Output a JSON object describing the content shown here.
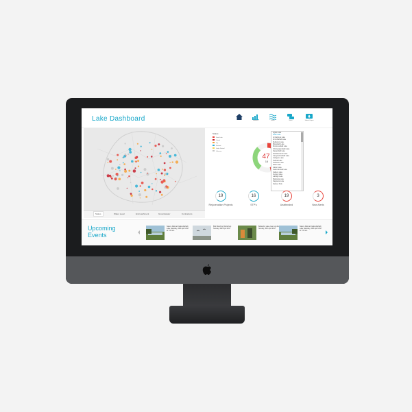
{
  "header": {
    "title": "Lake Dashboard",
    "nav": [
      {
        "icon": "home-icon",
        "label": ""
      },
      {
        "icon": "bar-chart-icon",
        "label": "Statistics"
      },
      {
        "icon": "water-waves-icon",
        "label": "Water"
      },
      {
        "icon": "chat-icon",
        "label": "News"
      },
      {
        "icon": "upload-icon",
        "label": "Submit Report"
      }
    ]
  },
  "map": {
    "tabs": [
      "Status",
      "Water Level",
      "Encroachment",
      "Groundwater",
      "Contractors"
    ],
    "active_tab": "Status",
    "point_colors": [
      "#e8443b",
      "#f6a23a",
      "#c51e2e",
      "#2bb0d6",
      "#c7c7c7"
    ]
  },
  "legend": {
    "title": "Status",
    "items": [
      {
        "label": "Dead Lake",
        "color": "#e8443b"
      },
      {
        "label": "Critical",
        "color": "#c51e2e"
      },
      {
        "label": "Dry",
        "color": "#f6a23a"
      },
      {
        "label": "Revived",
        "color": "#2bb0d6"
      },
      {
        "label": "Under Revival",
        "color": "#f1d35a"
      },
      {
        "label": "Unknown",
        "color": "#c7c7c7"
      }
    ]
  },
  "donut": {
    "center_value": "47",
    "sub_value": "16",
    "segments": [
      {
        "color": "#e8443b",
        "fraction": 0.46
      },
      {
        "color": "#f2f2f2",
        "fraction": 0.14
      },
      {
        "color": "#8dd57b",
        "fraction": 0.28
      },
      {
        "color": "#f3f3f3",
        "fraction": 0.12
      }
    ]
  },
  "lake_list": {
    "items": [
      "Agara Lake",
      "Allalli Lake",
      "Ambalipura Lake",
      "Amruthahalli Lake",
      "Bellandur Lake",
      "Bilekahalli Lake",
      "Bommanahalli Lake",
      "Chinnappanahalli Lake",
      "Dasarahalli Lake",
      "Doddanekundi Lake",
      "Gangondanahalli Lake",
      "Gottigere Lake",
      "Hebbal Lake",
      "Hulimavu Lake",
      "Ibblur Lake",
      "Jakkur Lake",
      "Kaikondrahalli Lake",
      "Kalkere Lake",
      "Kengeri Lake",
      "Lalbagh Lake",
      "Madiwala Lake",
      "Nagavara Lake",
      "Sankey Tank"
    ],
    "selected_index": 1
  },
  "stats": [
    {
      "value": "19",
      "label": "Rejuvenation Projects",
      "color": "#17a7c9"
    },
    {
      "value": "16",
      "label": "STP's",
      "color": "#17a7c9"
    },
    {
      "value": "19",
      "label": "Unattended",
      "color": "#e8443b"
    },
    {
      "value": "3",
      "label": "New Alerts",
      "color": "#e8443b"
    }
  ],
  "events": {
    "heading_line1": "Upcoming",
    "heading_line2": "Events",
    "items": [
      {
        "text": "Nature Walk at Kaikondrahalli Lake Saturday, 29th April 2017 at 7:00 am"
      },
      {
        "text": "Bird Watching Workshop Sunday, 30th April 2017"
      },
      {
        "text": "Bellandur Lake clean up drive Sunday, 30th April 2017"
      },
      {
        "text": "Nature Walk at Kaikondrahalli Lake Saturday, 29th April 2017 at 7:00 am"
      }
    ]
  }
}
